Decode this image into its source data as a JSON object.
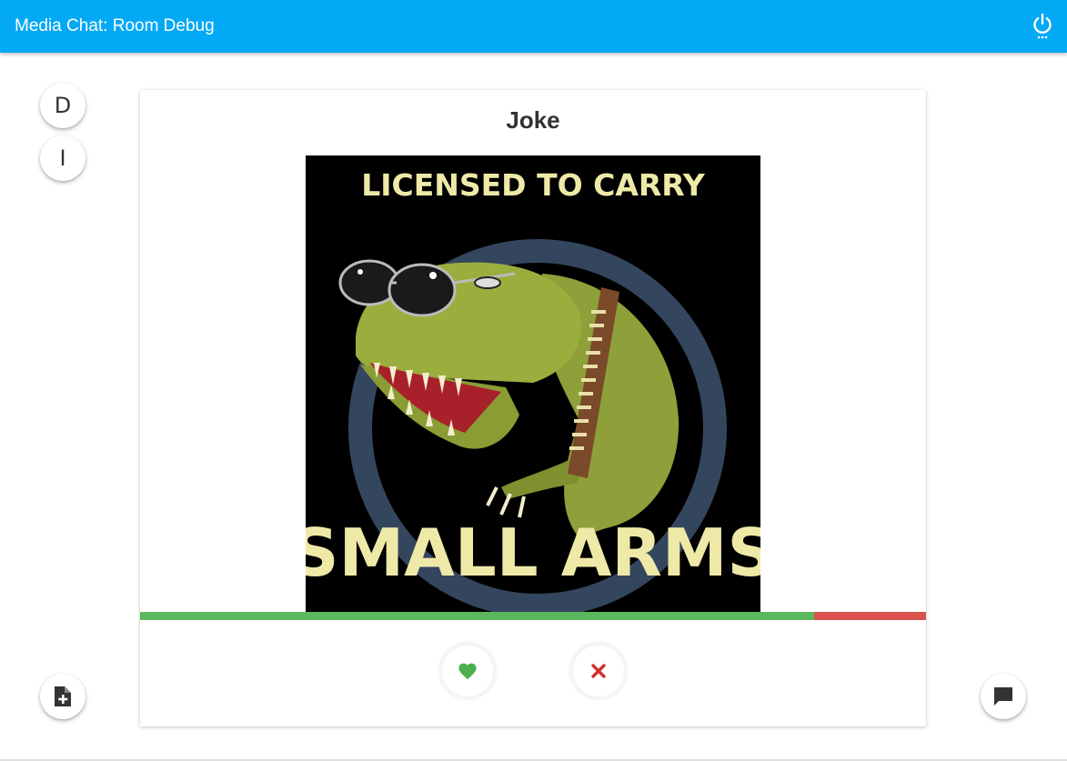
{
  "app": {
    "title": "Media Chat: Room Debug"
  },
  "side_buttons": [
    {
      "label": "D"
    },
    {
      "label": "I"
    }
  ],
  "card": {
    "title": "Joke",
    "image": {
      "top_text": "LICENSED TO CARRY",
      "bottom_text": "SMALL ARMS"
    },
    "votes": {
      "like_fraction": 0.858,
      "dislike_fraction": 0.142,
      "like_color": "#5cb85c",
      "dislike_color": "#d9534f"
    }
  },
  "icons": {
    "power": "power-icon",
    "add_file": "note-add-icon",
    "chat": "chat-icon",
    "like": "heart-icon",
    "dislike": "close-icon"
  },
  "colors": {
    "appbar": "#03a9f4",
    "like_icon": "#4caf50",
    "dislike_icon": "#d32f2f"
  }
}
